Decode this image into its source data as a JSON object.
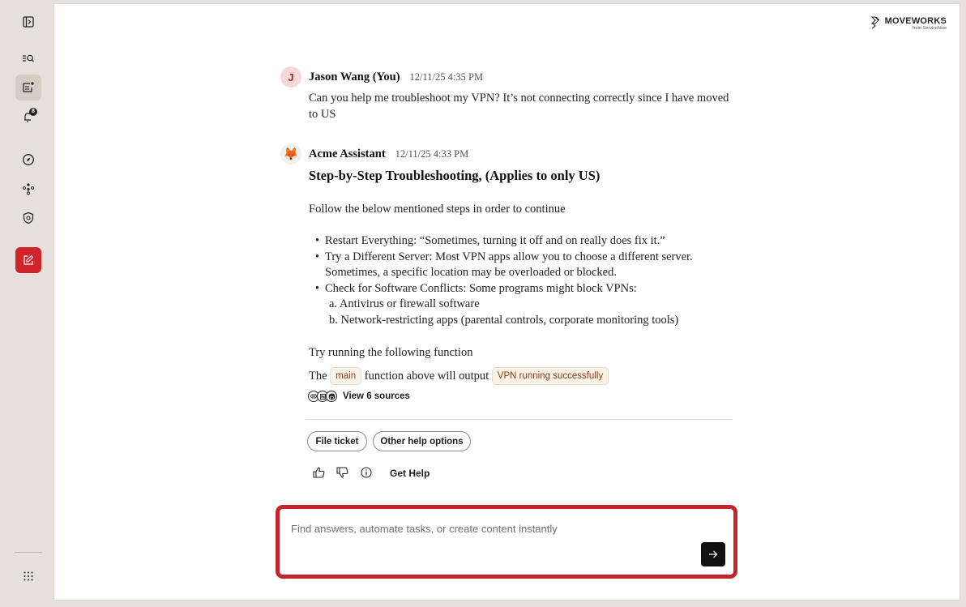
{
  "sidebar": {
    "icons": [
      "sidebar-toggle-icon",
      "search-icon",
      "new-chat-icon",
      "notifications-icon",
      "explore-icon",
      "agents-icon",
      "security-icon",
      "compose-icon",
      "apps-grid-icon"
    ],
    "notification_count": "8"
  },
  "brand": {
    "name": "MOVEWORKS",
    "sub": "from ServiceNow"
  },
  "conversation": {
    "user_message": {
      "avatar_initial": "J",
      "sender": "Jason Wang (You)",
      "timestamp": "12/11/25 4:35 PM",
      "text": "Can you help me troubleshoot my VPN? It’s not connecting correctly since I have moved to US"
    },
    "assistant_message": {
      "avatar_emoji": "🦊",
      "sender": "Acme Assistant",
      "timestamp": "12/11/25 4:33 PM",
      "heading": "Step-by-Step Troubleshooting, (Applies to only US)",
      "intro": "Follow the below mentioned steps in order to continue",
      "bullets": [
        "Restart Everything: “Sometimes, turning it off and on really does fix it.”",
        "Try a Different Server: Most VPN apps allow you to choose a different server. Sometimes, a specific location may be overloaded or blocked.",
        "Check for Software Conflicts: Some programs might block VPNs:"
      ],
      "sub_items": [
        "a. Antivirus or firewall software",
        "b. Network-restricting apps (parental controls, corporate monitoring tools)"
      ],
      "function_line": "Try running the following function",
      "output_prefix": "The",
      "code_function": "main",
      "output_middle": "function above will output",
      "code_output": "VPN running successfully",
      "sources_label": "View 6 sources",
      "source_icons": [
        "link-icon",
        "notion-icon",
        "github-icon"
      ]
    }
  },
  "actions": {
    "file_ticket": "File ticket",
    "other_help": "Other help options",
    "feedback_icons": [
      "thumbs-up-icon",
      "thumbs-down-icon",
      "info-icon"
    ],
    "get_help": "Get Help"
  },
  "composer": {
    "placeholder": "Find answers, automate tasks, or create content instantly",
    "value": ""
  },
  "colors": {
    "accent_red": "#c0262c",
    "sidebar_bg": "#e6e1dc",
    "code_bg": "#fbf2e7",
    "code_text": "#8a3b12"
  }
}
